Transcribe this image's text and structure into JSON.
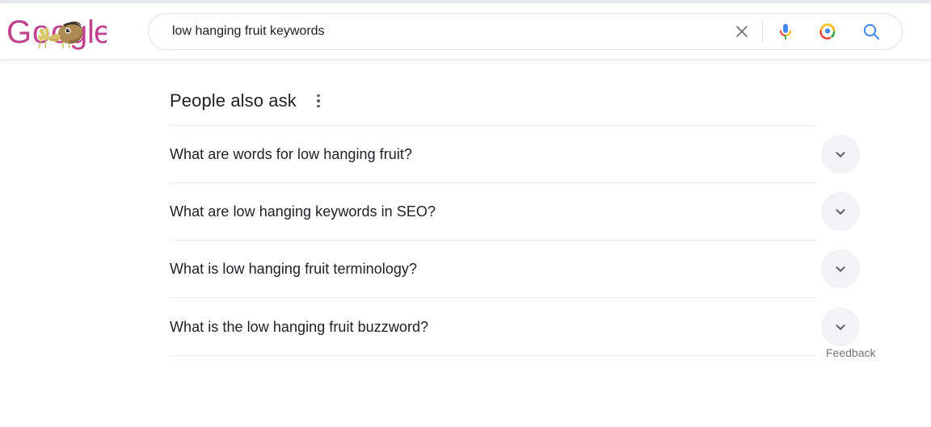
{
  "page": {
    "background_color": "#ffffff",
    "top_strip_color": "#e8eaed"
  },
  "header": {
    "logo": {
      "name": "google-doodle-logo",
      "alt_text": "Google",
      "letters": "Google",
      "letter_color": "#c2418d",
      "doodle_description": "duck with wheat stalks"
    },
    "search": {
      "value": "low hanging fruit keywords",
      "placeholder": "Search",
      "clear_label": "Clear",
      "voice_label": "Search by voice",
      "lens_label": "Search by image",
      "submit_label": "Google Search",
      "icons": {
        "clear": "close-icon",
        "voice": "microphone-icon",
        "lens": "google-lens-icon",
        "submit": "search-icon"
      },
      "accent_colors": {
        "blue": "#4285f4",
        "red": "#ea4335",
        "yellow": "#fbbc05",
        "green": "#34a853",
        "border": "#dfe1e5"
      }
    }
  },
  "main": {
    "people_also_ask": {
      "title": "People also ask",
      "menu_icon": "three-dot-vertical-icon",
      "menu_label": "About this result",
      "expand_icon": "chevron-down-icon",
      "questions": [
        {
          "text": "What are words for low hanging fruit?",
          "expanded": false
        },
        {
          "text": "What are low hanging keywords in SEO?",
          "expanded": false
        },
        {
          "text": "What is low hanging fruit terminology?",
          "expanded": false
        },
        {
          "text": "What is the low hanging fruit buzzword?",
          "expanded": false
        }
      ],
      "feedback_label": "Feedback"
    }
  }
}
